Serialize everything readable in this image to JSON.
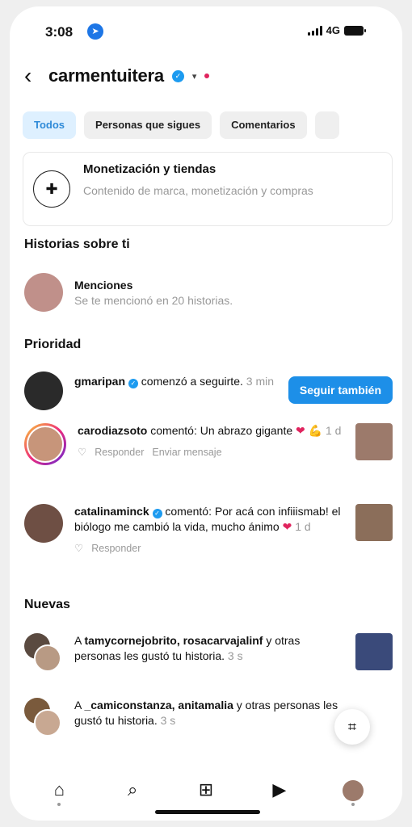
{
  "status": {
    "time": "3:08",
    "network": "4G"
  },
  "header": {
    "username": "carmentuitera"
  },
  "tabs": [
    "Todos",
    "Personas que sigues",
    "Comentarios"
  ],
  "monetization": {
    "title": "Monetización y tiendas",
    "subtitle": "Contenido de marca, monetización y compras"
  },
  "stories_section": {
    "title": "Historias sobre ti",
    "mentions_title": "Menciones",
    "mentions_sub": "Se te mencionó en 20 historias."
  },
  "priority": {
    "title": "Prioridad",
    "follow": {
      "user": "gmaripan",
      "text": "comenzó a seguirte.",
      "time": "3 min",
      "button": "Seguir también"
    },
    "comment1": {
      "user": "carodiazsoto",
      "text": "comentó: Un abrazo gigante",
      "time": "1 d",
      "reply": "Responder",
      "message": "Enviar mensaje"
    },
    "comment2": {
      "user": "catalinaminck",
      "text": "comentó: Por acá con infiiismab! el biólogo me cambió la vida, mucho ánimo",
      "time": "1 d",
      "reply": "Responder"
    }
  },
  "new": {
    "title": "Nuevas",
    "like1": {
      "prefix": "A",
      "users": "tamycornejobrito, rosacarvajalinf",
      "text": "y otras personas les gustó tu historia.",
      "time": "3 s"
    },
    "like2": {
      "prefix": "A",
      "users": "_camiconstanza, anitamalia",
      "text": "y otras personas les gustó tu historia.",
      "time": "3 s"
    }
  },
  "colors": {
    "accent": "#1d8fe8",
    "verified": "#1d9bf0",
    "heart": "#e0245e"
  },
  "icons": [
    "home-icon",
    "search-icon",
    "add-icon",
    "reels-icon",
    "profile-avatar",
    "heart-icon",
    "scan-icon"
  ]
}
